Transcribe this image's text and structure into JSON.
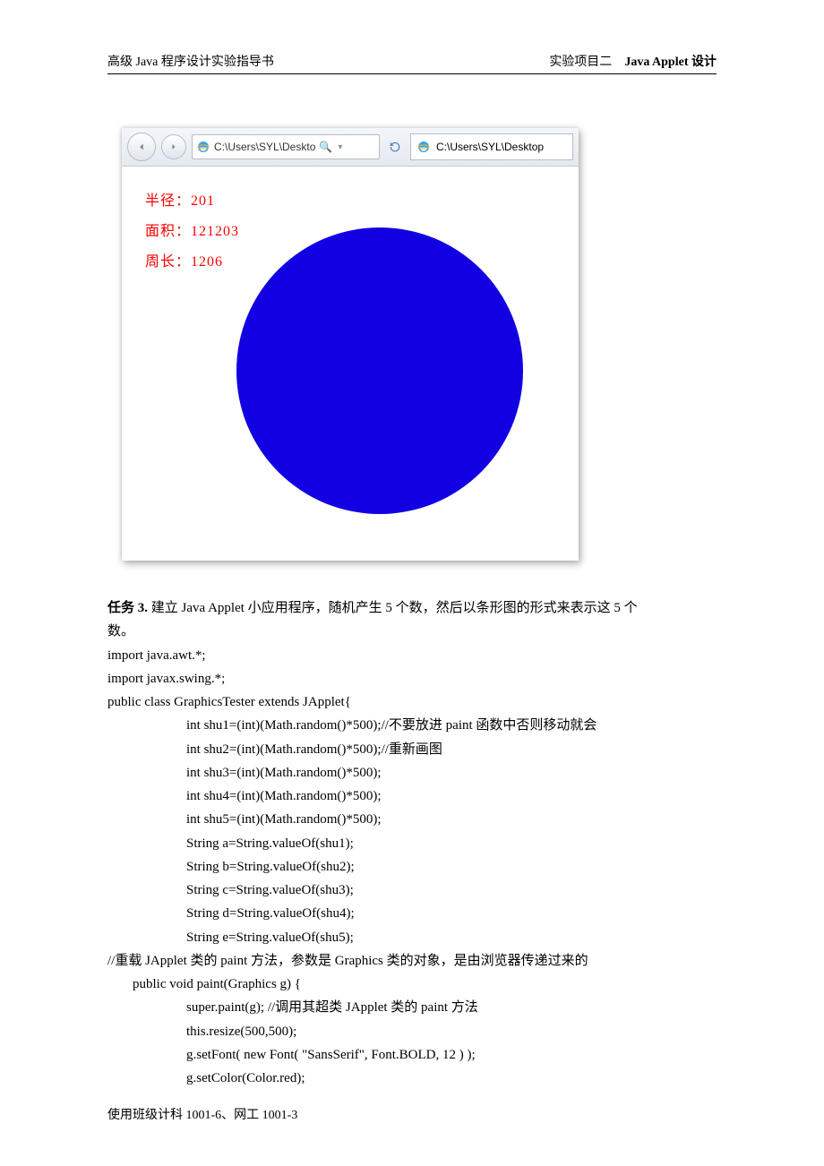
{
  "header": {
    "left": "高级 Java 程序设计实验指导书",
    "right_a": "实验项目二",
    "right_b": "Java Applet 设计"
  },
  "footer": "使用班级计科 1001-6、网工 1001-3",
  "browser": {
    "address": "C:\\Users\\SYL\\Deskto",
    "search_glyph": "🔍",
    "tab": "C:\\Users\\SYL\\Desktop"
  },
  "applet": {
    "line1": "半径：201",
    "line2": "面积：121203",
    "line3": "周长：1206"
  },
  "task": {
    "label": "任务 3.",
    "desc_a": " 建立 Java Applet 小应用程序，随机产生 5 个数，然后以条形图的形式来表示这 5 个",
    "desc_b": "数。"
  },
  "code": {
    "l01": "import java.awt.*;",
    "l02": "import javax.swing.*;",
    "l03": "public class GraphicsTester extends JApplet{",
    "l04": "int shu1=(int)(Math.random()*500);//不要放进 paint 函数中否则移动就会",
    "l05": "int shu2=(int)(Math.random()*500);//重新画图",
    "l06": "int shu3=(int)(Math.random()*500);",
    "l07": "int shu4=(int)(Math.random()*500);",
    "l08": "int shu5=(int)(Math.random()*500);",
    "l09": "String a=String.valueOf(shu1);",
    "l10": "String b=String.valueOf(shu2);",
    "l11": "String c=String.valueOf(shu3);",
    "l12": "String d=String.valueOf(shu4);",
    "l13": "String e=String.valueOf(shu5);",
    "l14": "//重载 JApplet 类的 paint 方法，参数是 Graphics 类的对象，是由浏览器传递过来的",
    "l15": "public void paint(Graphics g) {",
    "l16": "super.paint(g); //调用其超类 JApplet 类的 paint 方法",
    "l17": "this.resize(500,500);",
    "l18": "g.setFont( new Font( \"SansSerif\", Font.BOLD, 12 ) );",
    "l19": "",
    "l20": "g.setColor(Color.red);"
  }
}
